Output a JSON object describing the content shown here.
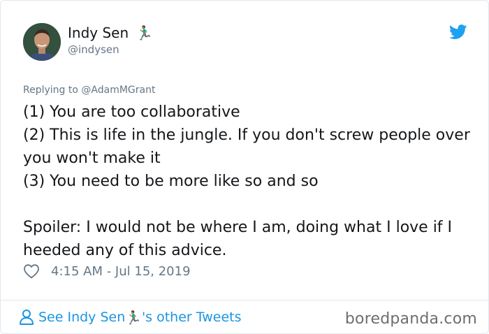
{
  "author": {
    "display_name": "Indy Sen",
    "name_emoji": "🏃🏽‍♂️",
    "handle": "@indysen"
  },
  "reply": {
    "prefix": "Replying to ",
    "mention": "@AdamMGrant"
  },
  "tweet": {
    "text": "(1) You are too collaborative\n(2) This is life in the jungle. If you don't screw people over you won't make it\n(3) You need to be more like so and so\n\nSpoiler: I would not be where I am, doing what I love if I heeded any of this advice.",
    "timestamp": "4:15 AM - Jul 15, 2019"
  },
  "footer": {
    "see_prefix": "See Indy Sen ",
    "see_emoji": "🏃🏽‍♂️",
    "see_suffix": "'s other Tweets"
  },
  "watermark": "boredpanda.com",
  "colors": {
    "twitter_blue": "#1da1f2",
    "link_blue": "#1b95e0",
    "muted_gray": "#657786",
    "text": "#14171a"
  },
  "icons": {
    "brand": "twitter-bird-icon",
    "like": "heart-icon",
    "profile": "person-icon"
  }
}
